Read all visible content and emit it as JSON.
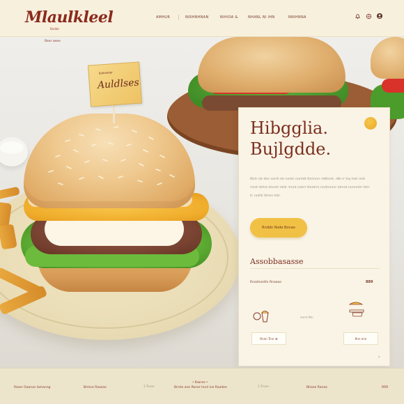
{
  "header": {
    "logo": "Mlaulkleel",
    "logo_sub": "Bndde",
    "nav": [
      "AMHUR",
      "NIRHNHNAN",
      "NIHIOA &",
      "NHANL NI IHN",
      "NNIHNNA"
    ],
    "icons": [
      "bell-icon",
      "globe-icon",
      "user-icon"
    ]
  },
  "hero": {
    "tag_label": "Reer oeee",
    "flag_small": "Biabseder",
    "flag_text": "Auldlses"
  },
  "card": {
    "title_line1": "Hibgglia.",
    "title_line2": "Bujlgdde.",
    "body": "Rtrtr ntr ttnr nnrrh ntr nnrtrr nnrrntt ttrrrnnrr rntttrrnt. rtth rr tny tntr rnnt rrnnt ntrtrn trnnrtr ntrtr. trnnt nntrrr ttnntrrn nnrtrnnrnr ntrnnt nnrrnntrr trtrr tr. nntrtr ttrrnn tntr.",
    "cta": "Rnddn Rode Bonao",
    "section_title": "Assobbasasse",
    "row_label": "Rnadnnnttn Rnaaoo",
    "row_value": "889",
    "feat_text": "nnnn tttn",
    "chip_left": "Rnnn Tinn ⌘",
    "chip_right": "Rnn nnn"
  },
  "footer": {
    "items": [
      "Raser Oaanas Iamanng",
      "Brmne Raasae",
      "Bnnde",
      "Brnhe ane Rener Innd ine Raadee",
      "Brnne",
      "Bhane Ranae",
      "RRR"
    ],
    "top_mark": "• Raanne •",
    "separators": [
      "1 Ruan",
      "1 Rnae"
    ]
  },
  "colors": {
    "brand": "#8a2a1d",
    "accent": "#f1c145",
    "card_bg": "#f9f4e6",
    "header_bg": "#f7f0dd"
  }
}
